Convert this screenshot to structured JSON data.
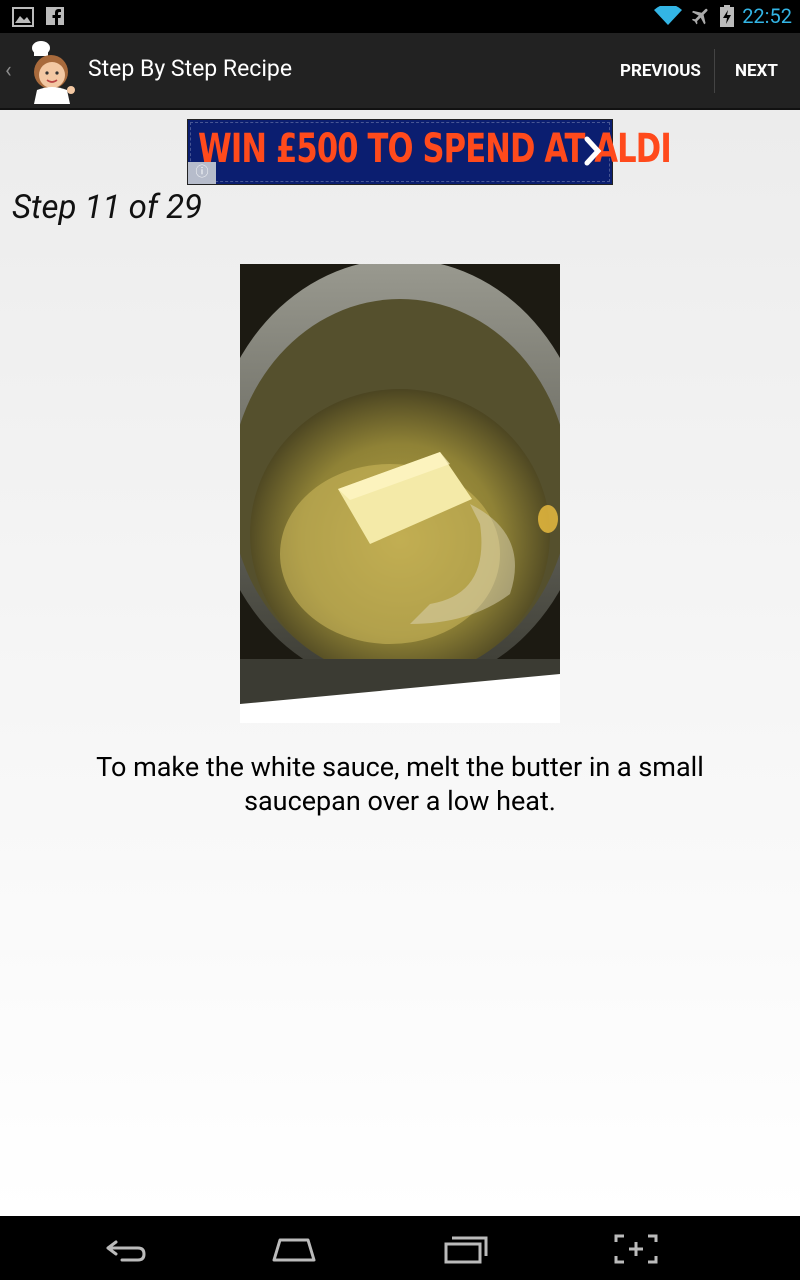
{
  "status_bar": {
    "time": "22:52",
    "icons": [
      "gallery-icon",
      "facebook-icon",
      "wifi-icon",
      "airplane-mode-icon",
      "battery-charging-icon"
    ]
  },
  "action_bar": {
    "title": "Step By Step Recipe",
    "previous_label": "PREVIOUS",
    "next_label": "NEXT",
    "logo": "chef-logo-icon"
  },
  "ad": {
    "text": "WIN £500 TO SPEND AT ALDI",
    "info_icon": "info-icon",
    "arrow_icon": "chevron-right-icon",
    "colors": {
      "background": "#0b1e70",
      "text": "#ff4a1c"
    }
  },
  "step": {
    "label": "Step 11 of 29",
    "image_alt": "butter melting in saucepan",
    "instruction": "To make the white sauce, melt the butter in a small saucepan over a low heat."
  },
  "nav_bar": {
    "buttons": [
      "back-icon",
      "home-icon",
      "recent-apps-icon",
      "screenshot-icon"
    ]
  },
  "colors": {
    "accent": "#33b5e5",
    "action_bar": "#222222"
  }
}
